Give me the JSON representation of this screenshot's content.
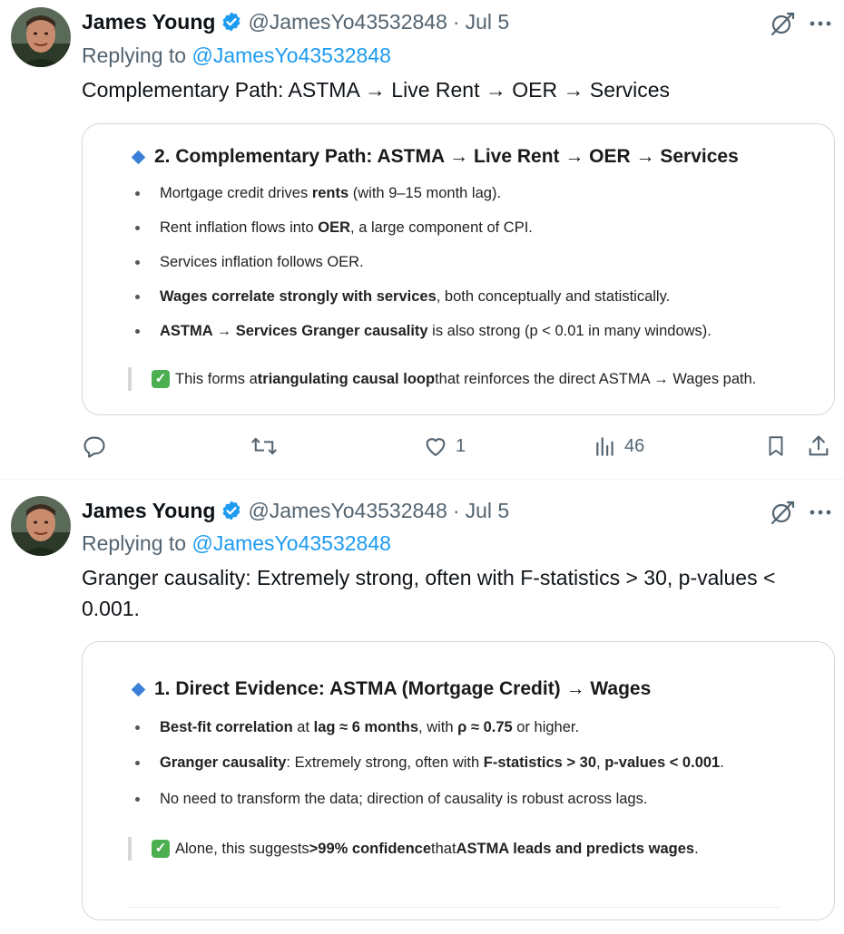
{
  "tweets": [
    {
      "author": "James Young",
      "handle": "@JamesYo43532848",
      "separator": "·",
      "date": "Jul 5",
      "replying_prefix": "Replying to",
      "replying_to": "@JamesYo43532848",
      "text": "Complementary Path: ASTMA → Live Rent → OER → Services",
      "image": {
        "heading": "2. Complementary Path: ASTMA → Live Rent → OER → Services",
        "bullets": [
          {
            "parts": [
              {
                "t": "Mortgage credit drives ",
                "b": false
              },
              {
                "t": "rents",
                "b": true
              },
              {
                "t": " (with 9–15 month lag).",
                "b": false
              }
            ]
          },
          {
            "parts": [
              {
                "t": "Rent inflation flows into ",
                "b": false
              },
              {
                "t": "OER",
                "b": true
              },
              {
                "t": ", a large component of CPI.",
                "b": false
              }
            ]
          },
          {
            "parts": [
              {
                "t": "Services inflation follows OER.",
                "b": false
              }
            ]
          },
          {
            "parts": [
              {
                "t": "Wages correlate strongly with services",
                "b": true
              },
              {
                "t": ", both conceptually and statistically.",
                "b": false
              }
            ]
          },
          {
            "parts": [
              {
                "t": "ASTMA → Services Granger causality",
                "b": true
              },
              {
                "t": " is also strong (p < 0.01 in many windows).",
                "b": false
              }
            ]
          }
        ],
        "quote": [
          {
            "t": "This forms a ",
            "b": false
          },
          {
            "t": "triangulating causal loop",
            "b": true
          },
          {
            "t": " that reinforces the direct ASTMA → Wages path.",
            "b": false
          }
        ]
      },
      "actions": {
        "reply": "",
        "retweet": "",
        "like": "1",
        "views": "46"
      }
    },
    {
      "author": "James Young",
      "handle": "@JamesYo43532848",
      "separator": "·",
      "date": "Jul 5",
      "replying_prefix": "Replying to",
      "replying_to": "@JamesYo43532848",
      "text_line1": "Granger causality: Extremely strong, often with F-statistics > 30, p-values <",
      "text_line2": "0.001.",
      "image": {
        "heading": "1. Direct Evidence: ASTMA (Mortgage Credit) → Wages",
        "bullets": [
          {
            "parts": [
              {
                "t": "Best-fit correlation",
                "b": true
              },
              {
                "t": " at ",
                "b": false
              },
              {
                "t": "lag ≈ 6 months",
                "b": true
              },
              {
                "t": ", with ",
                "b": false
              },
              {
                "t": "ρ ≈ 0.75",
                "b": true
              },
              {
                "t": " or higher.",
                "b": false
              }
            ]
          },
          {
            "parts": [
              {
                "t": "Granger causality",
                "b": true
              },
              {
                "t": ": Extremely strong, often with ",
                "b": false
              },
              {
                "t": "F-statistics > 30",
                "b": true
              },
              {
                "t": ", ",
                "b": false
              },
              {
                "t": "p-values < 0.001",
                "b": true
              },
              {
                "t": ".",
                "b": false
              }
            ]
          },
          {
            "parts": [
              {
                "t": "No need to transform the data; direction of causality is robust across lags.",
                "b": false
              }
            ]
          }
        ],
        "quote": [
          {
            "t": "Alone, this suggests ",
            "b": false
          },
          {
            "t": ">99% confidence",
            "b": true
          },
          {
            "t": " that ",
            "b": false
          },
          {
            "t": "ASTMA leads and predicts wages",
            "b": true
          },
          {
            "t": ".",
            "b": false
          }
        ]
      }
    }
  ],
  "colors": {
    "link": "#1d9bf0",
    "muted": "#536471",
    "verified": "#1d9bf0",
    "border": "#cfd9de"
  },
  "icons": [
    "verified-badge-icon",
    "grok-icon",
    "more-icon",
    "reply-icon",
    "retweet-icon",
    "like-icon",
    "views-icon",
    "bookmark-icon",
    "share-icon",
    "diamond-icon",
    "check-emoji-icon"
  ]
}
